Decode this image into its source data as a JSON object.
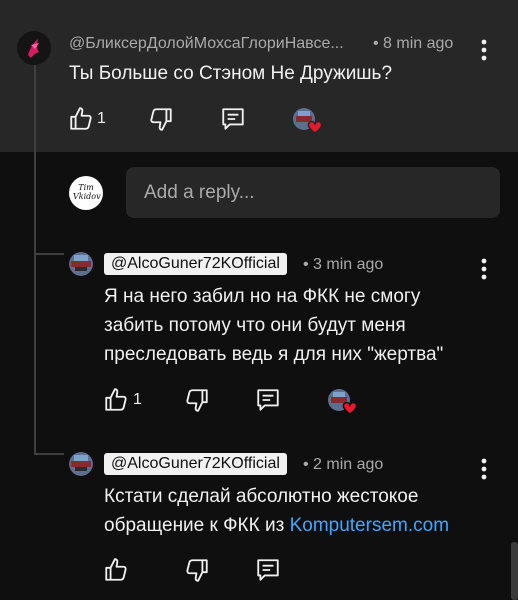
{
  "comment": {
    "author": "@БликсерДолойМохсаГлориНавсе...",
    "time": "• 8 min ago",
    "text": "Ты Больше со Стэном Не Дружишь?",
    "likes": "1"
  },
  "reply_box": {
    "placeholder": "Add a reply...",
    "avatar_text": "Tim Vkidov"
  },
  "replies": [
    {
      "author": "@AlcoGuner72KOfficial",
      "time": "• 3 min ago",
      "lines": [
        "Я на него забил но на ФКК не смогу",
        "забить потому что они будут меня",
        "преследовать ведь я для них \"жертва\""
      ],
      "likes": "1"
    },
    {
      "author": "@AlcoGuner72KOfficial",
      "time": "• 2 min ago",
      "line1": "Кстати сделай абсолютно жестокое",
      "line2_prefix": "обращение к ФКК из ",
      "link": "Komputersem.com"
    }
  ],
  "colors": {
    "accent_link": "#3ea6ff",
    "heart": "#e8192c",
    "background": "#0f0f0f",
    "highlight_bg": "#272727"
  },
  "icons": [
    "more-vertical-icon",
    "thumb-up-icon",
    "thumb-down-icon",
    "reply-icon",
    "creator-heart-icon"
  ]
}
